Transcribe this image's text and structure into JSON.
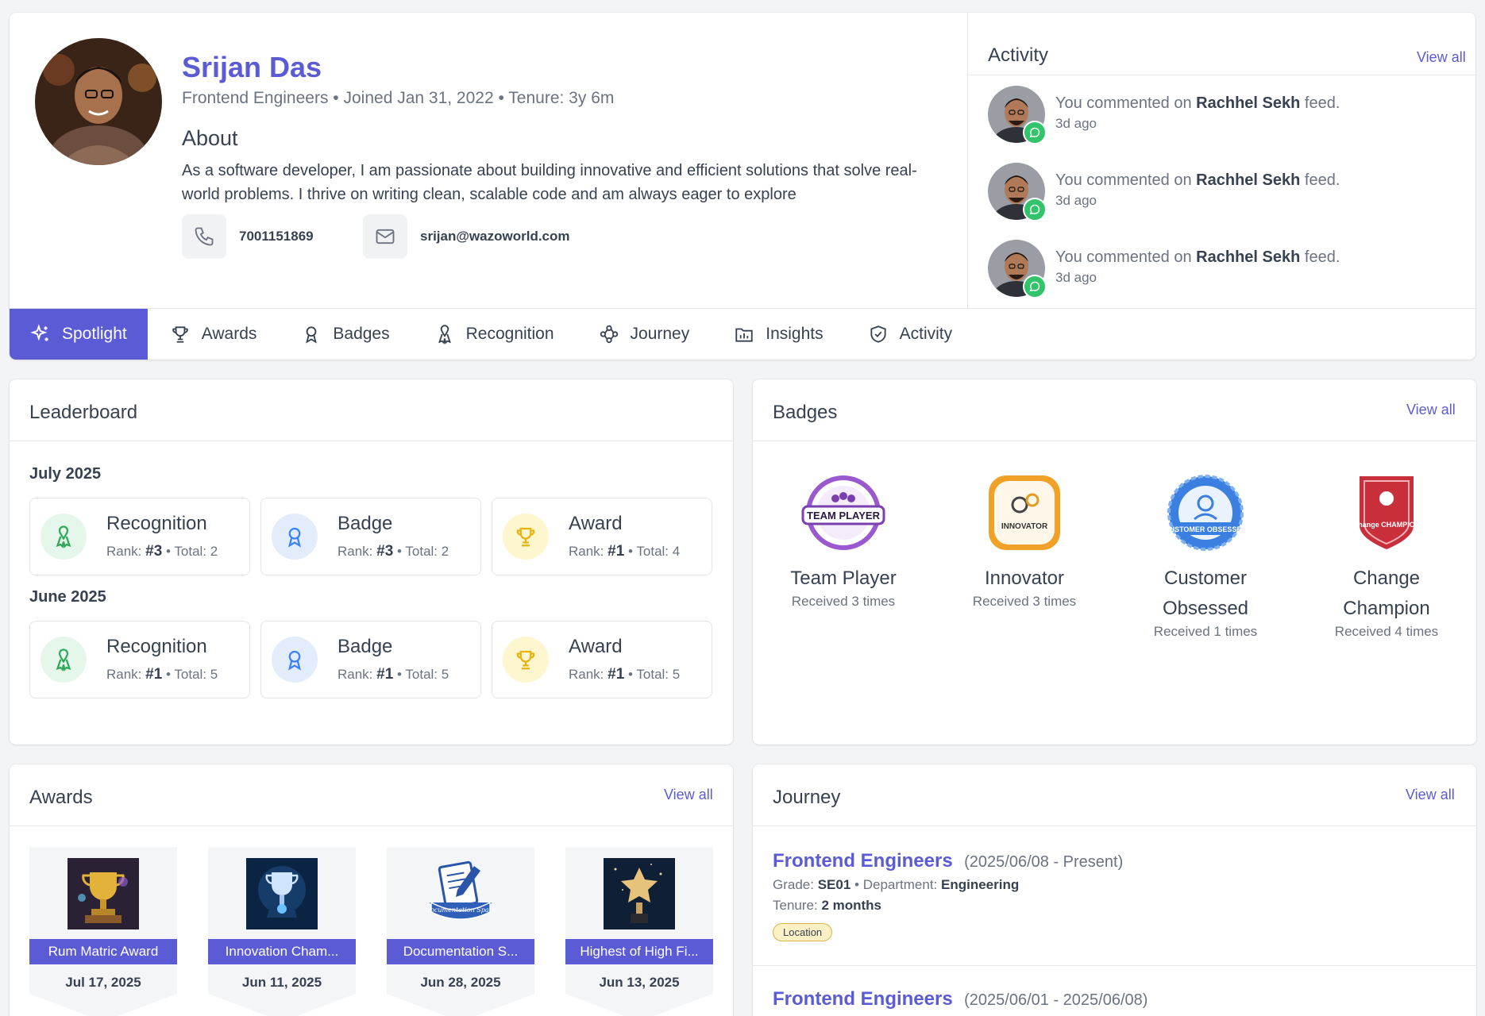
{
  "profile": {
    "name": "Srijan Das",
    "role": "Frontend Engineers",
    "joined": "Joined Jan 31, 2022",
    "tenure": "Tenure: 3y 6m",
    "about_title": "About",
    "about_text": "As a software developer, I am passionate about building innovative and efficient solutions that solve real-world problems. I thrive on writing clean, scalable code and am always eager to explore",
    "phone": "7001151869",
    "email": "srijan@wazoworld.com"
  },
  "activity": {
    "title": "Activity",
    "view_all": "View all",
    "items": [
      {
        "prefix": "You commented on",
        "target": "Rachhel Sekh",
        "suffix": "feed.",
        "time": "3d ago"
      },
      {
        "prefix": "You commented on",
        "target": "Rachhel Sekh",
        "suffix": "feed.",
        "time": "3d ago"
      },
      {
        "prefix": "You commented on",
        "target": "Rachhel Sekh",
        "suffix": "feed.",
        "time": "3d ago"
      }
    ]
  },
  "tabs": [
    {
      "label": "Spotlight",
      "icon": "sparkle-icon",
      "active": true
    },
    {
      "label": "Awards",
      "icon": "trophy-icon"
    },
    {
      "label": "Badges",
      "icon": "medal-icon"
    },
    {
      "label": "Recognition",
      "icon": "ribbon-icon"
    },
    {
      "label": "Journey",
      "icon": "route-icon"
    },
    {
      "label": "Insights",
      "icon": "chart-folder-icon"
    },
    {
      "label": "Activity",
      "icon": "shield-check-icon"
    }
  ],
  "leaderboard": {
    "title": "Leaderboard",
    "months": [
      {
        "label": "July 2025",
        "entries": [
          {
            "label": "Recognition",
            "rank_label": "Rank:",
            "rank": "#3",
            "total": "Total: 2"
          },
          {
            "label": "Badge",
            "rank_label": "Rank:",
            "rank": "#3",
            "total": "Total: 2"
          },
          {
            "label": "Award",
            "rank_label": "Rank:",
            "rank": "#1",
            "total": "Total: 4"
          }
        ]
      },
      {
        "label": "June 2025",
        "entries": [
          {
            "label": "Recognition",
            "rank_label": "Rank:",
            "rank": "#1",
            "total": "Total: 5"
          },
          {
            "label": "Badge",
            "rank_label": "Rank:",
            "rank": "#1",
            "total": "Total: 5"
          },
          {
            "label": "Award",
            "rank_label": "Rank:",
            "rank": "#1",
            "total": "Total: 5"
          }
        ]
      }
    ]
  },
  "badges": {
    "title": "Badges",
    "view_all": "View all",
    "items": [
      {
        "name": "Team Player",
        "received": "Received 3 times",
        "emblem_text": "TEAM PLAYER"
      },
      {
        "name": "Innovator",
        "received": "Received 3 times",
        "emblem_text": "INNOVATOR"
      },
      {
        "name": "Customer Obsessed",
        "received": "Received 1 times",
        "emblem_text": "CUSTOMER OBSESSED"
      },
      {
        "name": "Change Champion",
        "received": "Received 4 times",
        "emblem_text": "Change CHAMPION"
      }
    ]
  },
  "awards": {
    "title": "Awards",
    "view_all": "View all",
    "items": [
      {
        "name": "Rum Matric Award",
        "date": "Jul 17, 2025"
      },
      {
        "name": "Innovation Cham...",
        "date": "Jun 11, 2025"
      },
      {
        "name": "Documentation S...",
        "date": "Jun 28, 2025",
        "emblem_text": "Documentation Spark"
      },
      {
        "name": "Highest of High Fi...",
        "date": "Jun 13, 2025"
      }
    ]
  },
  "journey": {
    "title": "Journey",
    "view_all": "View all",
    "items": [
      {
        "role": "Frontend Engineers",
        "range": "(2025/06/08 - Present)",
        "grade_label": "Grade:",
        "grade": "SE01",
        "dept_label": "Department:",
        "dept": "Engineering",
        "tenure_label": "Tenure:",
        "tenure": "2 months",
        "tag": "Location"
      },
      {
        "role": "Frontend Engineers",
        "range": "(2025/06/01 - 2025/06/08)"
      }
    ]
  },
  "colors": {
    "accent": "#5b5bd6",
    "status_green": "#31c46b"
  }
}
